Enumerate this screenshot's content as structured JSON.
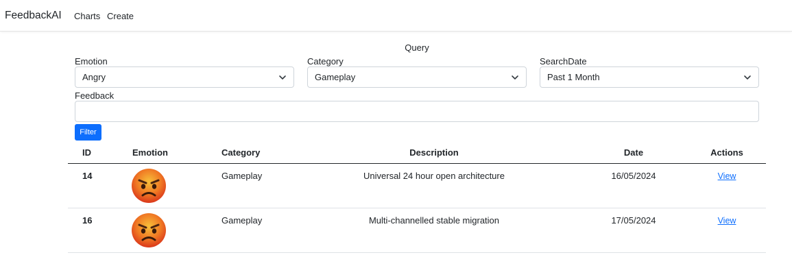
{
  "app": {
    "brand": "FeedbackAI",
    "nav": [
      {
        "label": "Charts"
      },
      {
        "label": "Create"
      }
    ]
  },
  "query": {
    "title": "Query",
    "emotion": {
      "label": "Emotion",
      "value": "Angry"
    },
    "category": {
      "label": "Category",
      "value": "Gameplay"
    },
    "search_date": {
      "label": "SearchDate",
      "value": "Past 1 Month"
    },
    "feedback": {
      "label": "Feedback",
      "value": ""
    },
    "filter_button": "Filter"
  },
  "table": {
    "headers": [
      "ID",
      "Emotion",
      "Category",
      "Description",
      "Date",
      "Actions"
    ],
    "rows": [
      {
        "id": "14",
        "emotion_icon": "angry-face-icon",
        "category": "Gameplay",
        "description": "Universal 24 hour open architecture",
        "date": "16/05/2024",
        "action": "View"
      },
      {
        "id": "16",
        "emotion_icon": "angry-face-icon",
        "category": "Gameplay",
        "description": "Multi-channelled stable migration",
        "date": "17/05/2024",
        "action": "View"
      }
    ]
  },
  "colors": {
    "primary": "#0d6efd",
    "text": "#212529",
    "border": "#ced4da",
    "emoji_top": "#f5a623",
    "emoji_bottom": "#e0391b"
  }
}
